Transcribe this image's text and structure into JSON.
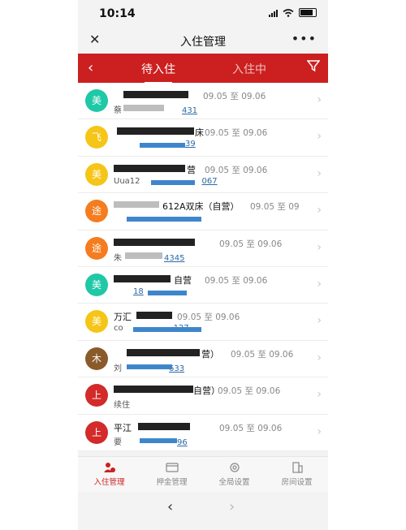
{
  "status": {
    "time": "10:14"
  },
  "appbar": {
    "close_icon": "close-icon",
    "title": "入住管理",
    "more": "•••"
  },
  "tabs": {
    "back": "‹",
    "pending": "待入住",
    "checked_in": "入住中"
  },
  "colors": {
    "brand_red": "#cc1f1f",
    "teal": "#1fc8a6",
    "yellow": "#f5c518",
    "orange": "#f57c1f",
    "brown": "#8a5a2b",
    "red": "#d32a2a"
  },
  "rows": [
    {
      "avatar": "美",
      "color": "#1fc8a6",
      "name": "",
      "date": "09.05 至 09.06",
      "sub": "蔡",
      "num": "431"
    },
    {
      "avatar": "飞",
      "color": "#f5c518",
      "name": "床",
      "date": "09.05 至 09.06",
      "sub": "",
      "num": "39"
    },
    {
      "avatar": "美",
      "color": "#f5c518",
      "name": "营",
      "date": "09.05 至 09.06",
      "sub": "Uua12",
      "num": "067"
    },
    {
      "avatar": "途",
      "color": "#f57c1f",
      "name": "612A双床（自营）",
      "date": "09.05 至 09",
      "sub": "",
      "num": ""
    },
    {
      "avatar": "途",
      "color": "#f57c1f",
      "name": "",
      "date": "09.05 至 09.06",
      "sub": "朱",
      "num": "4345"
    },
    {
      "avatar": "美",
      "color": "#1fc8a6",
      "name": "自营",
      "date": "09.05 至 09.06",
      "sub": "",
      "num": "18"
    },
    {
      "avatar": "美",
      "color": "#f5c518",
      "name": "万汇",
      "date": "09.05 至 09.06",
      "sub": "co",
      "num": "127"
    },
    {
      "avatar": "木",
      "color": "#8a5a2b",
      "name": "营）",
      "date": "09.05 至 09.06",
      "sub": "刘",
      "num": "633"
    },
    {
      "avatar": "上",
      "color": "#d32a2a",
      "name": "自营）",
      "date": "09.05 至 09.06",
      "sub": "续住",
      "num": ""
    },
    {
      "avatar": "上",
      "color": "#d32a2a",
      "name": "平江",
      "date": "09.05 至 09.06",
      "sub": "要",
      "num": "96"
    }
  ],
  "bottomnav": [
    {
      "label": "入住管理",
      "icon": "checkin-icon",
      "active": true
    },
    {
      "label": "押金管理",
      "icon": "deposit-icon",
      "active": false
    },
    {
      "label": "全局设置",
      "icon": "gear-icon",
      "active": false
    },
    {
      "label": "房间设置",
      "icon": "building-icon",
      "active": false
    }
  ]
}
